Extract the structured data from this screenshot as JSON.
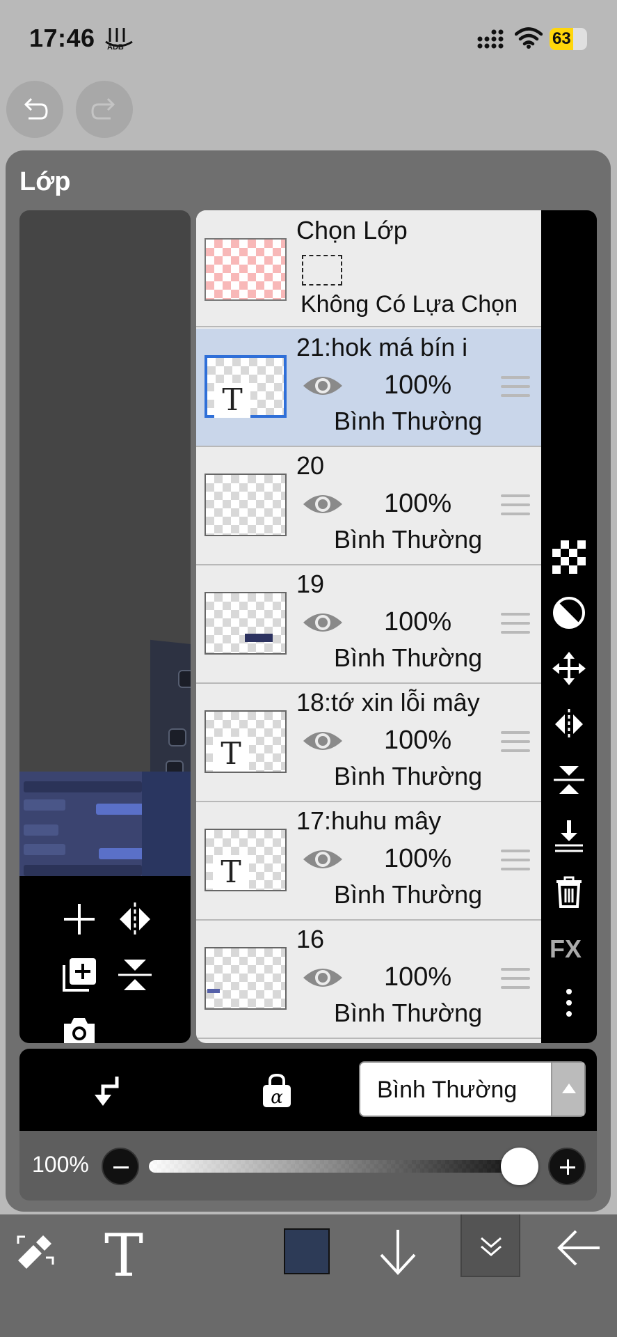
{
  "status_bar": {
    "time": "17:46",
    "battery": "63",
    "battery_level": 0.63,
    "battery_color": "#ffd60a",
    "icons": [
      "app-notification-icon",
      "cellular-signal-icon",
      "wifi-icon",
      "battery-icon"
    ]
  },
  "history": {
    "undo_icon": "undo-icon",
    "redo_icon": "redo-icon",
    "redo_enabled": false
  },
  "panel": {
    "title": "Lớp"
  },
  "selection_layer": {
    "title": "Chọn Lớp",
    "status": "Không Có Lựa Chọn"
  },
  "layers": [
    {
      "name": "21:hok má bín i",
      "opacity": "100%",
      "blend": "Bình Thường",
      "type": "text",
      "selected": true
    },
    {
      "name": "20",
      "opacity": "100%",
      "blend": "Bình Thường",
      "type": "image",
      "selected": false
    },
    {
      "name": "19",
      "opacity": "100%",
      "blend": "Bình Thường",
      "type": "image",
      "selected": false
    },
    {
      "name": "18:tớ xin lỗi mây",
      "opacity": "100%",
      "blend": "Bình Thường",
      "type": "text",
      "selected": false
    },
    {
      "name": "17:huhu mây",
      "opacity": "100%",
      "blend": "Bình Thường",
      "type": "text",
      "selected": false
    },
    {
      "name": "16",
      "opacity": "100%",
      "blend": "Bình Thường",
      "type": "image",
      "selected": false
    }
  ],
  "preview_tools": [
    "add-layer-icon",
    "flip-horizontal-icon",
    "duplicate-layer-icon",
    "flip-vertical-icon",
    "camera-icon"
  ],
  "side_tools": {
    "icons": [
      "transparency-grid-icon",
      "invert-icon",
      "move-icon",
      "flip-horizontal-icon",
      "flip-vertical-icon",
      "merge-down-icon",
      "trash-icon",
      "fx-icon",
      "more-vertical-icon"
    ],
    "fx_label": "FX"
  },
  "layer_options": {
    "clipping_icon": "clipping-icon",
    "alpha_lock_icon": "alpha-lock-icon",
    "blend_mode": "Bình Thường"
  },
  "opacity": {
    "label": "100%",
    "value": 1.0
  },
  "toolbar": {
    "text_tool": "T",
    "current_color": "#2d3b57",
    "icons": [
      "transform-tool-icon",
      "text-tool-icon",
      "color-swatch",
      "arrow-down-icon",
      "chevrons-down-icon",
      "arrow-left-icon"
    ]
  }
}
